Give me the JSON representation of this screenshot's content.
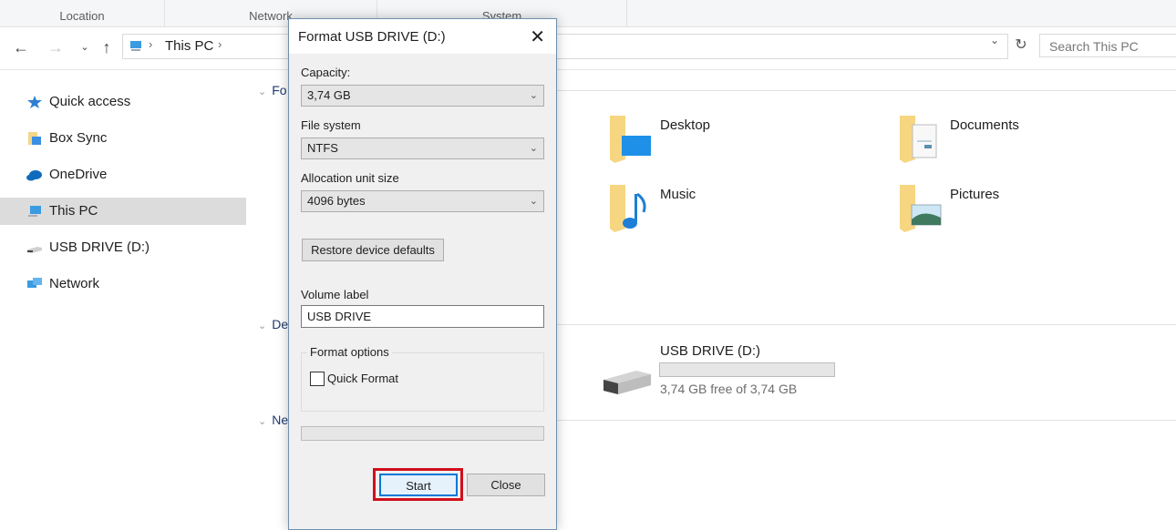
{
  "ribbon": {
    "groups": [
      "Location",
      "Network",
      "System"
    ]
  },
  "nav": {
    "back_icon": "back-arrow-icon",
    "forward_icon": "forward-arrow-icon",
    "recent_icon": "chevron-down-icon",
    "up_icon": "up-arrow-icon"
  },
  "address": {
    "crumb": "This PC",
    "separator": "›",
    "refresh_icon": "refresh-icon",
    "dropdown_icon": "chevron-down-icon"
  },
  "search": {
    "placeholder": "Search This PC"
  },
  "sidebar": {
    "items": [
      {
        "label": "Quick access",
        "icon": "star-icon"
      },
      {
        "label": "Box Sync",
        "icon": "box-sync-folder-icon"
      },
      {
        "label": "OneDrive",
        "icon": "cloud-icon"
      },
      {
        "label": "This PC",
        "icon": "computer-icon",
        "selected": true
      },
      {
        "label": "USB DRIVE (D:)",
        "icon": "usb-drive-icon"
      },
      {
        "label": "Network",
        "icon": "network-icon"
      }
    ]
  },
  "content": {
    "sections": [
      {
        "label": "Folders",
        "visible_text": "Fo"
      },
      {
        "label": "Devices and drives",
        "visible_text": "De"
      },
      {
        "label": "Network locations",
        "visible_text": "Ne"
      }
    ],
    "folders": [
      {
        "name": "Desktop",
        "icon": "desktop-folder-icon"
      },
      {
        "name": "Documents",
        "icon": "documents-folder-icon"
      },
      {
        "name": "Music",
        "icon": "music-folder-icon"
      },
      {
        "name": "Pictures",
        "icon": "pictures-folder-icon"
      }
    ],
    "drive": {
      "name": "USB DRIVE (D:)",
      "free_text": "3,74 GB free of 3,74 GB",
      "used_fraction": 0
    }
  },
  "dialog": {
    "title": "Format USB DRIVE (D:)",
    "close_icon": "close-icon",
    "capacity_label": "Capacity:",
    "capacity_value": "3,74 GB",
    "filesystem_label": "File system",
    "filesystem_value": "NTFS",
    "alloc_label": "Allocation unit size",
    "alloc_value": "4096 bytes",
    "restore_button": "Restore device defaults",
    "volume_label": "Volume label",
    "volume_value": "USB DRIVE",
    "format_options_label": "Format options",
    "quick_format_label": "Quick Format",
    "quick_format_checked": false,
    "progress_fraction": 0,
    "start_button": "Start",
    "close_button": "Close",
    "highlight_color": "#d0101b"
  }
}
